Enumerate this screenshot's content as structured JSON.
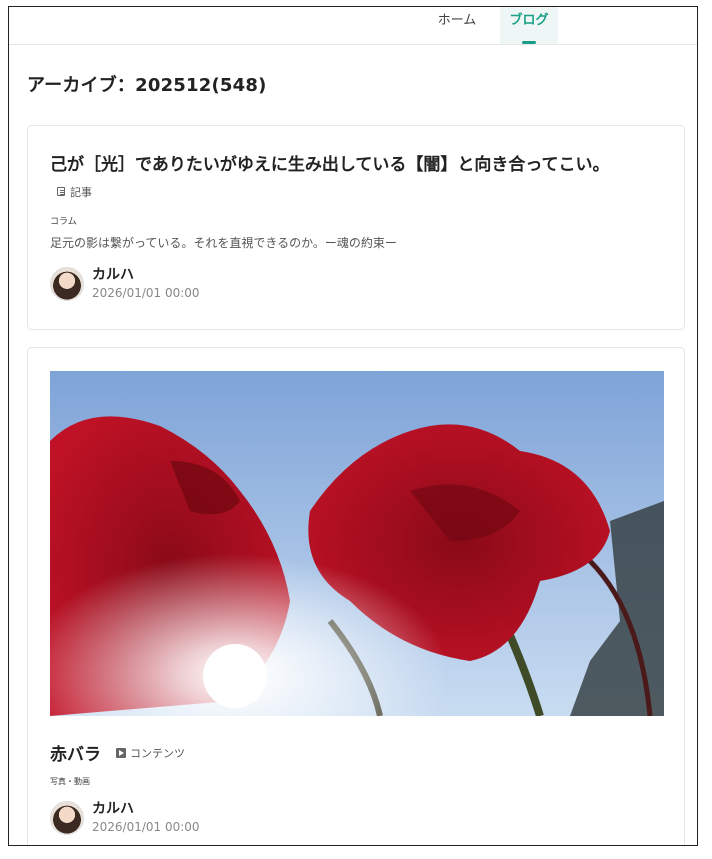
{
  "nav": {
    "items": [
      {
        "label": "ホーム"
      },
      {
        "label": "ブログ"
      }
    ]
  },
  "page": {
    "title": "アーカイブ：202512(548)"
  },
  "posts": [
    {
      "title": "己が［光］でありたいがゆえに生み出している【闇】と向き合ってこい。",
      "type": "記事",
      "type_icon": "document-icon",
      "category": "コラム",
      "excerpt": "足元の影は繋がっている。それを直視できるのか。ー魂の約束ー",
      "author": "カルハ",
      "date": "2026/01/01 00:00"
    },
    {
      "title": "赤バラ",
      "type": "コンテンツ",
      "type_icon": "play-icon",
      "category": "写真・動画",
      "image": "red-roses-against-blue-sky-photo",
      "author": "カルハ",
      "date": "2026/01/01 00:00"
    }
  ],
  "colors": {
    "accent": "#1a9f86",
    "accent_bg": "#eef7f5"
  }
}
